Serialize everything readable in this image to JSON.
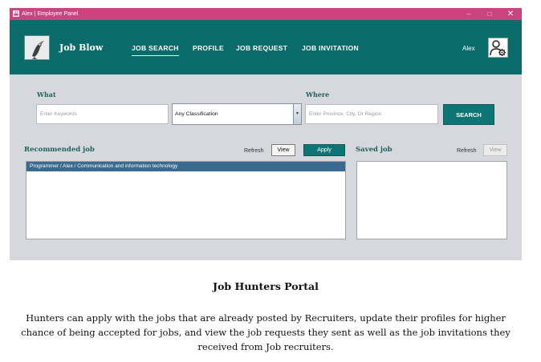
{
  "window": {
    "title": "Alex | Employee Panel",
    "controls": {
      "minimize": "–",
      "maximize": "□",
      "close": "✕"
    },
    "titlebar_color": "#c9457f"
  },
  "header": {
    "brand": "Job Blow",
    "nav": [
      {
        "label": "JOB SEARCH",
        "active": true
      },
      {
        "label": "PROFILE"
      },
      {
        "label": "JOB REQUEST"
      },
      {
        "label": "JOB INVITATION"
      }
    ],
    "user_name": "Alex",
    "user_icon": "user-gear-icon",
    "logo_icon": "bird-logo-icon",
    "header_color": "#0b6b6b"
  },
  "search": {
    "what_label": "What",
    "keywords_placeholder": "Enter Keywords",
    "classification_selected": "Any Classification",
    "where_label": "Where",
    "location_placeholder": "Enter Province, City, Or Region",
    "search_button": "SEARCH"
  },
  "recommended": {
    "title": "Recommended job",
    "refresh": "Refresh",
    "view": "View",
    "apply": "Apply",
    "items": [
      "Programmer  /  Alex / Communication and information technology"
    ]
  },
  "saved": {
    "title": "Saved job",
    "refresh": "Refresh",
    "view": "View",
    "items": []
  },
  "caption": {
    "title": "Job Hunters Portal",
    "body": "Hunters can apply with the jobs that are already posted by Recruiters, update their profiles for higher chance of being accepted for jobs, and view the job requests they sent as well as the job invitations they received from Job recruiters."
  },
  "accent_color": "#0e7474"
}
